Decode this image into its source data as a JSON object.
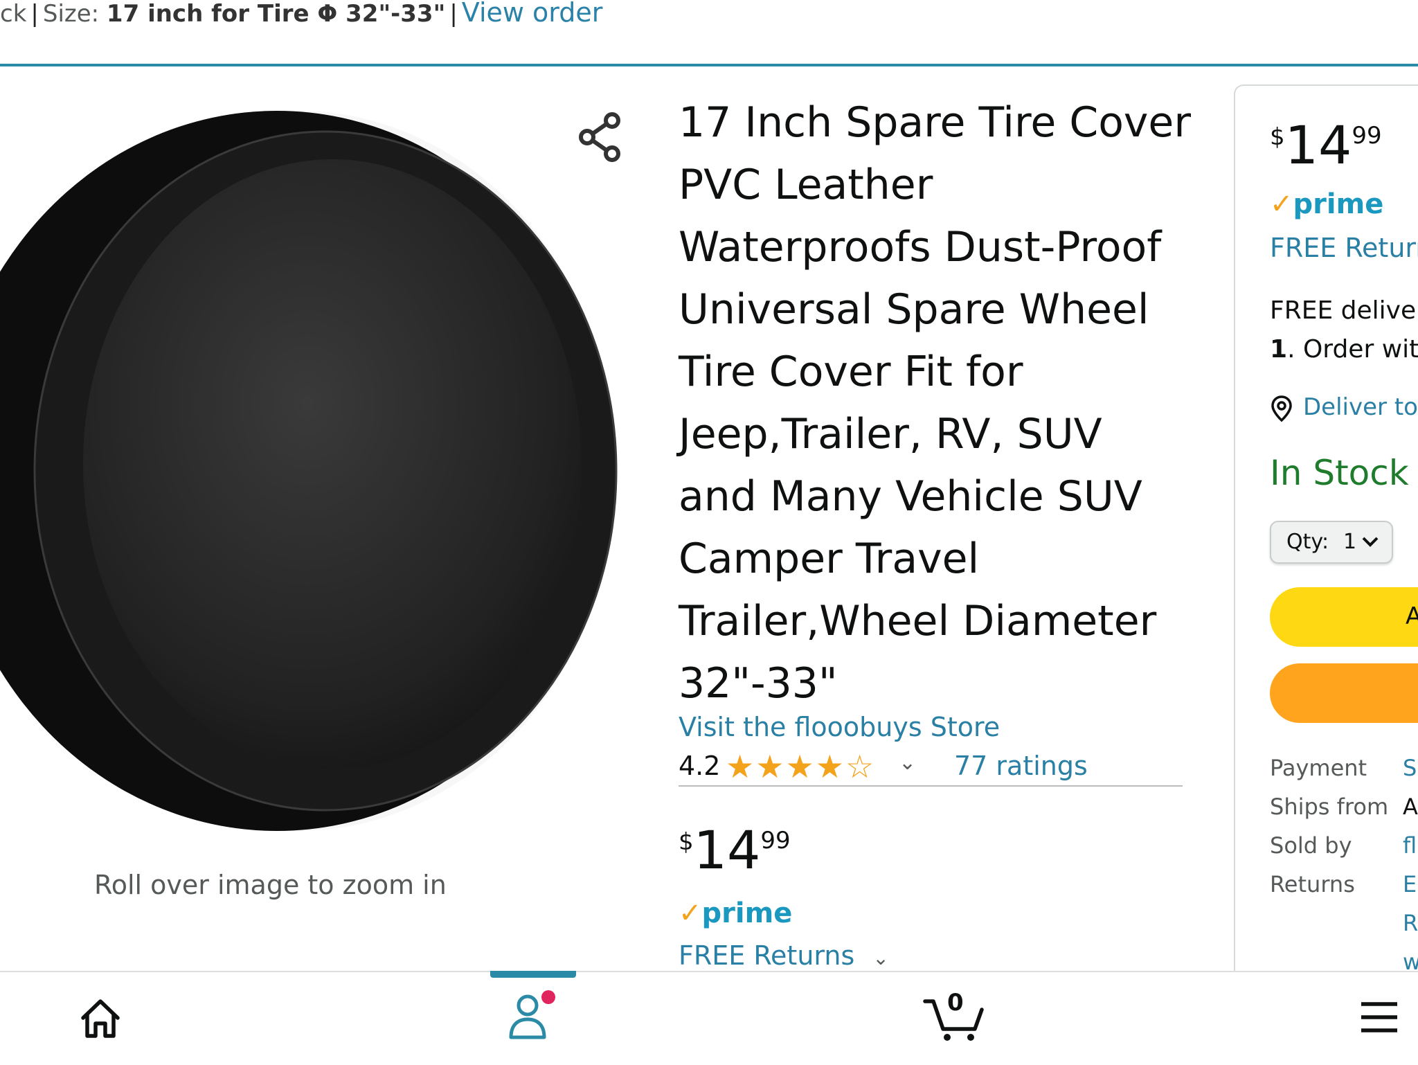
{
  "top_banner": {
    "lead": "ck",
    "size_label": "Size:",
    "size_value": "17 inch for Tire Φ 32\"-33\"",
    "view_order": "View order"
  },
  "product": {
    "title": "17 Inch Spare Tire Cover PVC Leather Waterproofs Dust-Proof Universal Spare Wheel Tire Cover Fit for Jeep,Trailer, RV, SUV and Many Vehicle SUV Camper Travel Trailer,Wheel Diameter 32\"-33\"",
    "store_link": "Visit the flooobuys Store",
    "rating_value": "4.2",
    "rating_stars": 4.2,
    "ratings_count": "77 ratings",
    "zoom_hint": "Roll over image to zoom in",
    "price": {
      "currency": "$",
      "whole": "14",
      "fraction": "99"
    },
    "prime_label": "prime",
    "free_returns": "FREE Returns"
  },
  "buy_box": {
    "price": {
      "currency": "$",
      "whole": "14",
      "fraction": "99"
    },
    "prime_label": "prime",
    "free_returns": "FREE Return",
    "delivery": "FREE deliver",
    "order_num": "1",
    "order_text": ". Order wit",
    "deliver_to": "Deliver to",
    "stock": "In Stock",
    "qty_label": "Qty:",
    "qty_value": "1",
    "add_to_cart": "A",
    "info": {
      "payment_label": "Payment",
      "payment_value": "S",
      "ships_label": "Ships from",
      "ships_value": "A",
      "sold_label": "Sold by",
      "sold_value": "fl",
      "returns_label": "Returns",
      "returns_value": "E",
      "returns_value2": "R",
      "returns_value3": "w"
    }
  },
  "bottom_nav": {
    "cart_count": "0"
  },
  "colors": {
    "link": "#2a7fa4",
    "prime": "#1a98c0",
    "star": "#f3a21c",
    "in_stock": "#1e7c2c",
    "add_to_cart": "#ffd814",
    "buy_now": "#ffa41c",
    "accent_bar": "#2b8aa6"
  }
}
